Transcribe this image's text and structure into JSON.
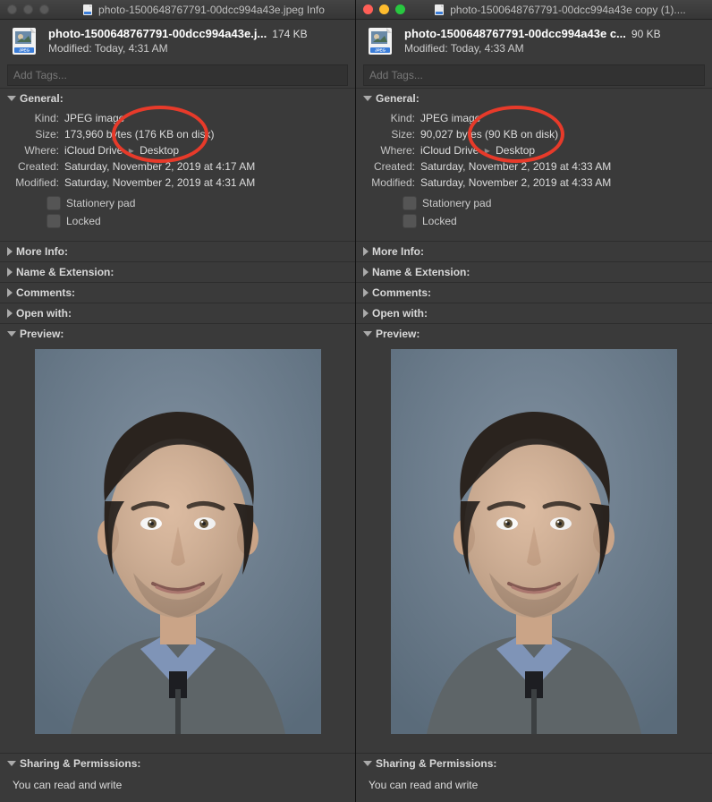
{
  "left": {
    "titlebar": "photo-1500648767791-00dcc994a43e.jpeg Info",
    "traffic_active": false,
    "file_name": "photo-1500648767791-00dcc994a43e.j...",
    "file_size_header": "174 KB",
    "modified_header": "Modified: Today, 4:31 AM",
    "tags_placeholder": "Add Tags...",
    "general": {
      "title": "General:",
      "kind_label": "Kind:",
      "kind": "JPEG image",
      "size_label": "Size:",
      "size": "173,960 bytes (176 KB on disk)",
      "where_label": "Where:",
      "where_a": "iCloud Drive",
      "where_b": "Desktop",
      "created_label": "Created:",
      "created": "Saturday, November 2, 2019 at 4:17 AM",
      "modified_label": "Modified:",
      "modified": "Saturday, November 2, 2019 at 4:31 AM",
      "stationery": "Stationery pad",
      "locked": "Locked"
    },
    "sections": {
      "more_info": "More Info:",
      "name_ext": "Name & Extension:",
      "comments": "Comments:",
      "open_with": "Open with:",
      "preview": "Preview:",
      "sharing": "Sharing & Permissions:"
    },
    "perm_text": "You can read and write"
  },
  "right": {
    "titlebar": "photo-1500648767791-00dcc994a43e copy (1)....",
    "traffic_active": true,
    "file_name": "photo-1500648767791-00dcc994a43e c...",
    "file_size_header": "90 KB",
    "modified_header": "Modified: Today, 4:33 AM",
    "tags_placeholder": "Add Tags...",
    "general": {
      "title": "General:",
      "kind_label": "Kind:",
      "kind": "JPEG image",
      "size_label": "Size:",
      "size": "90,027 bytes (90 KB on disk)",
      "where_label": "Where:",
      "where_a": "iCloud Drive",
      "where_b": "Desktop",
      "created_label": "Created:",
      "created": "Saturday, November 2, 2019 at 4:33 AM",
      "modified_label": "Modified:",
      "modified": "Saturday, November 2, 2019 at 4:33 AM",
      "stationery": "Stationery pad",
      "locked": "Locked"
    },
    "sections": {
      "more_info": "More Info:",
      "name_ext": "Name & Extension:",
      "comments": "Comments:",
      "open_with": "Open with:",
      "preview": "Preview:",
      "sharing": "Sharing & Permissions:"
    },
    "perm_text": "You can read and write"
  }
}
